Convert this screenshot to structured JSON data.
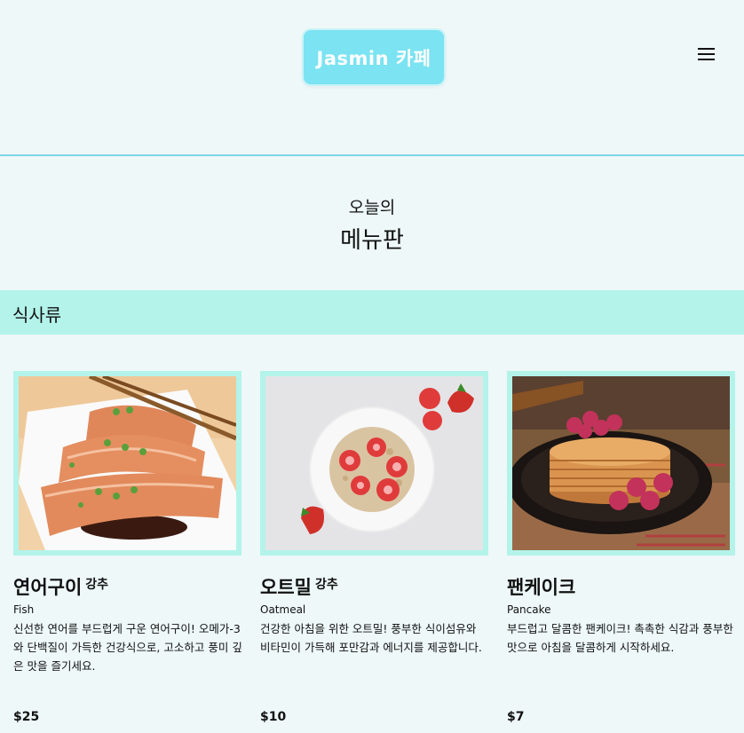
{
  "header": {
    "logo_text": "Jasmin 카페",
    "menu_icon": "hamburger-menu-icon"
  },
  "page": {
    "subtitle": "오늘의",
    "title": "메뉴판"
  },
  "category": {
    "label": "식사류"
  },
  "items": [
    {
      "name": "연어구이",
      "badge": "강추",
      "english": "Fish",
      "description": "신선한 연어를 부드럽게 구운 연어구이! 오메가-3와 단백질이 가득한 건강식으로, 고소하고 풍미 깊은 맛을 즐기세요.",
      "price": "$25",
      "image": "grilled-salmon"
    },
    {
      "name": "오트밀",
      "badge": "강추",
      "english": "Oatmeal",
      "description": "건강한 아침을 위한 오트밀! 풍부한 식이섬유와 비타민이 가득해 포만감과 에너지를 제공합니다.",
      "price": "$10",
      "image": "oatmeal-bowl"
    },
    {
      "name": "팬케이크",
      "badge": "",
      "english": "Pancake",
      "description": "부드럽고 달콤한 팬케이크! 촉촉한 식감과 풍부한 맛으로 아침을 달콤하게 시작하세요.",
      "price": "$7",
      "image": "pancake-stack"
    }
  ],
  "colors": {
    "background": "#eef8f8",
    "logo_bg": "#7be3f2",
    "accent_border": "#b3f3ea",
    "divider": "#7fd4e6"
  }
}
